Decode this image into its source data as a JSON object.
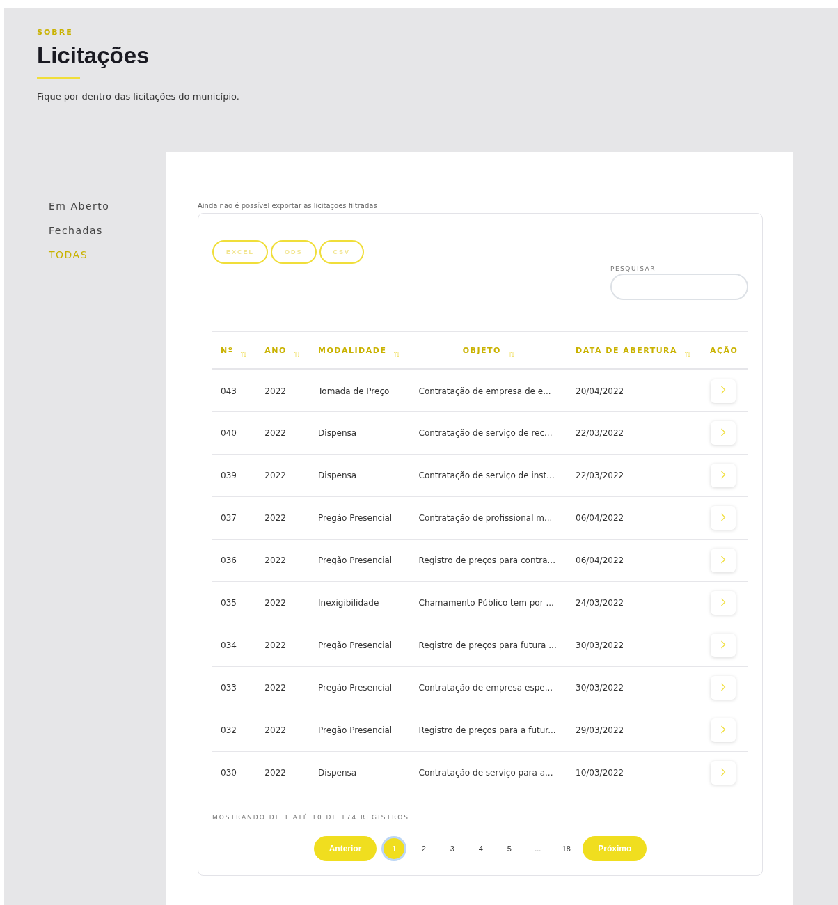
{
  "header": {
    "eyebrow": "SOBRE",
    "title": "Licitações",
    "subtitle": "Fique por dentro das licitações do município."
  },
  "sidebar": {
    "items": [
      {
        "label": "Em Aberto",
        "selected": false
      },
      {
        "label": "Fechadas",
        "selected": false
      },
      {
        "label": "TODAS",
        "selected": true
      }
    ]
  },
  "export_note": "Ainda não é possível exportar as licitações filtradas",
  "export_buttons": [
    "EXCEL",
    "ODS",
    "CSV"
  ],
  "search": {
    "label": "PESQUISAR"
  },
  "table": {
    "columns": [
      {
        "label": "Nº",
        "sortable": true
      },
      {
        "label": "ANO",
        "sortable": true
      },
      {
        "label": "MODALIDADE",
        "sortable": true
      },
      {
        "label": "OBJETO",
        "sortable": true
      },
      {
        "label": "DATA DE ABERTURA",
        "sortable": true
      },
      {
        "label": "AÇÃO",
        "sortable": false
      }
    ],
    "rows": [
      [
        "043",
        "2022",
        "Tomada de Preço",
        "Contratação de empresa de e...",
        "20/04/2022"
      ],
      [
        "040",
        "2022",
        "Dispensa",
        "Contratação de serviço de rec...",
        "22/03/2022"
      ],
      [
        "039",
        "2022",
        "Dispensa",
        "Contratação de serviço de inst...",
        "22/03/2022"
      ],
      [
        "037",
        "2022",
        "Pregão Presencial",
        "Contratação de profissional m...",
        "06/04/2022"
      ],
      [
        "036",
        "2022",
        "Pregão Presencial",
        "Registro de preços para contra...",
        "06/04/2022"
      ],
      [
        "035",
        "2022",
        "Inexigibilidade",
        "Chamamento Público tem por ...",
        "24/03/2022"
      ],
      [
        "034",
        "2022",
        "Pregão Presencial",
        "Registro de preços para futura ...",
        "30/03/2022"
      ],
      [
        "033",
        "2022",
        "Pregão Presencial",
        "Contratação de empresa espe...",
        "30/03/2022"
      ],
      [
        "032",
        "2022",
        "Pregão Presencial",
        "Registro de preços para a futur...",
        "29/03/2022"
      ],
      [
        "030",
        "2022",
        "Dispensa",
        "Contratação de serviço para a...",
        "10/03/2022"
      ]
    ]
  },
  "summary": "MOSTRANDO DE 1 ATÉ 10 DE 174 REGISTROS",
  "pagination": {
    "previous": "Anterior",
    "next": "Próximo",
    "pages": [
      {
        "label": "1",
        "selected": true
      },
      {
        "label": "2",
        "selected": false
      },
      {
        "label": "3",
        "selected": false
      },
      {
        "label": "4",
        "selected": false
      },
      {
        "label": "5",
        "selected": false
      },
      {
        "label": "...",
        "selected": false
      },
      {
        "label": "18",
        "selected": false
      }
    ]
  }
}
